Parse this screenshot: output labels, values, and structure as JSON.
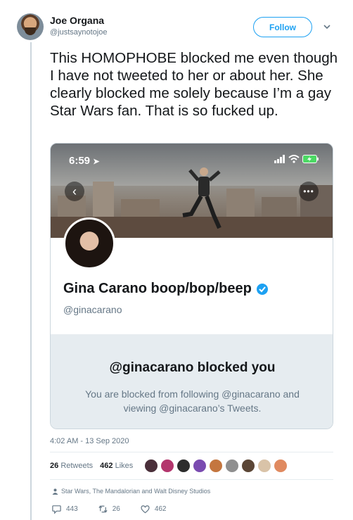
{
  "author": {
    "display_name": "Joe Organa",
    "handle": "@justsaynotojoe"
  },
  "follow_label": "Follow",
  "tweet_text": "This HOMOPHOBE blocked me even though I have not tweeted to her or about her. She clearly blocked me solely because I’m a gay Star Wars fan. That is so fucked up.",
  "screenshot": {
    "status_time": "6:59",
    "profile_name": "Gina Carano boop/bop/beep",
    "profile_handle": "@ginacarano",
    "blocked_title": "@ginacarano blocked you",
    "blocked_description": "You are blocked from following @ginacarano and viewing @ginacarano’s Tweets."
  },
  "timestamp": "4:02 AM - 13 Sep 2020",
  "stats": {
    "retweets_count": "26",
    "retweets_label": "Retweets",
    "likes_count": "462",
    "likes_label": "Likes"
  },
  "liker_avatar_colors": [
    "#4a2f3a",
    "#b3366d",
    "#2c2c2c",
    "#7a4bb0",
    "#c4763f",
    "#8f8f8f",
    "#5b4636",
    "#d9c3a8",
    "#e08a60"
  ],
  "context": "Star Wars, The Mandalorian and Walt Disney Studios",
  "actions": {
    "replies": "443",
    "retweets": "26",
    "likes": "462"
  },
  "colors": {
    "accent": "#1da1f2",
    "secondary_text": "#657786",
    "border": "#ccd6dd",
    "panel": "#e6ecf0"
  }
}
